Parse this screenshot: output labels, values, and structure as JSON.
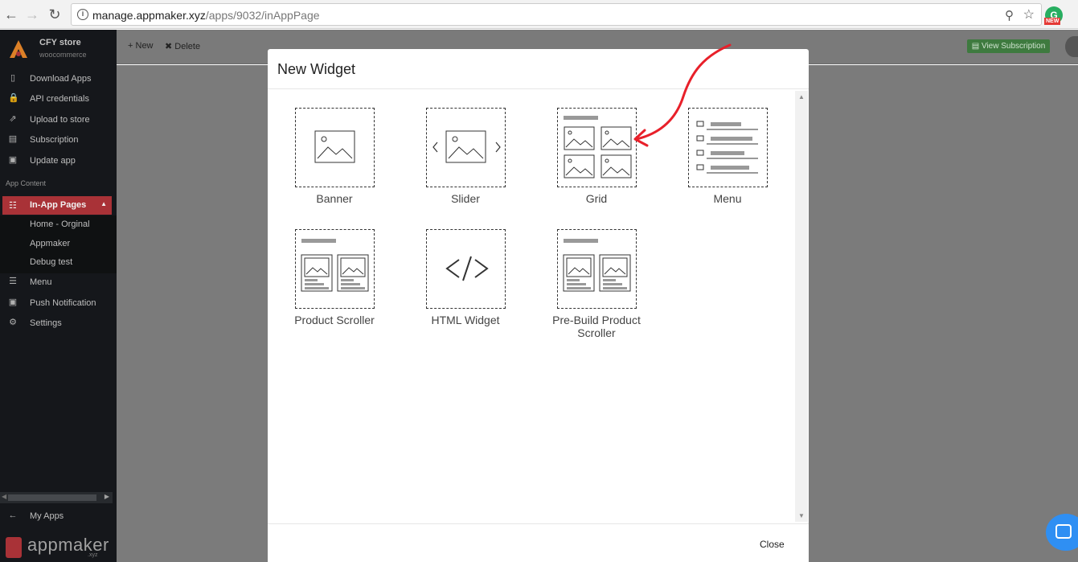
{
  "browser": {
    "url_host": "manage.appmaker.xyz",
    "url_path": "/apps/9032/inAppPage",
    "ext_badge": "NEW"
  },
  "sidebar": {
    "store_name": "CFY store",
    "store_platform": "woocommerce",
    "items": [
      {
        "label": "Download Apps",
        "icon": "phone-icon"
      },
      {
        "label": "API credentials",
        "icon": "lock-icon"
      },
      {
        "label": "Upload to store",
        "icon": "upload-icon"
      },
      {
        "label": "Subscription",
        "icon": "card-icon"
      },
      {
        "label": "Update app",
        "icon": "update-icon"
      }
    ],
    "section_label": "App Content",
    "active_item": "In-App Pages",
    "sub_items": [
      "Home - Orginal",
      "Appmaker",
      "Debug test"
    ],
    "lower_items": [
      {
        "label": "Menu",
        "icon": "menu-icon"
      },
      {
        "label": "Push Notification",
        "icon": "notification-icon"
      },
      {
        "label": "Settings",
        "icon": "gear-icon"
      }
    ],
    "my_apps": "My Apps",
    "footer_brand": "appmaker",
    "footer_tld": ".xyz"
  },
  "topbar": {
    "new_label": "New",
    "delete_label": "Delete",
    "subscription_label": "View Subscription"
  },
  "modal": {
    "title": "New Widget",
    "close_label": "Close",
    "widgets": [
      {
        "label": "Banner",
        "icon": "banner-icon"
      },
      {
        "label": "Slider",
        "icon": "slider-icon"
      },
      {
        "label": "Grid",
        "icon": "grid-icon"
      },
      {
        "label": "Menu",
        "icon": "menu-list-icon"
      },
      {
        "label": "Product Scroller",
        "icon": "product-scroller-icon"
      },
      {
        "label": "HTML Widget",
        "icon": "html-icon"
      },
      {
        "label": "Pre-Build Product Scroller",
        "icon": "prebuild-scroller-icon"
      }
    ]
  },
  "colors": {
    "sidebar_bg": "#17191d",
    "active_red": "#b3353a",
    "overlay_gray": "#7b7b7b",
    "annotation_arrow": "#e8202a",
    "chat_blue": "#2f8ff3",
    "subscription_green": "#3e7a3f"
  }
}
